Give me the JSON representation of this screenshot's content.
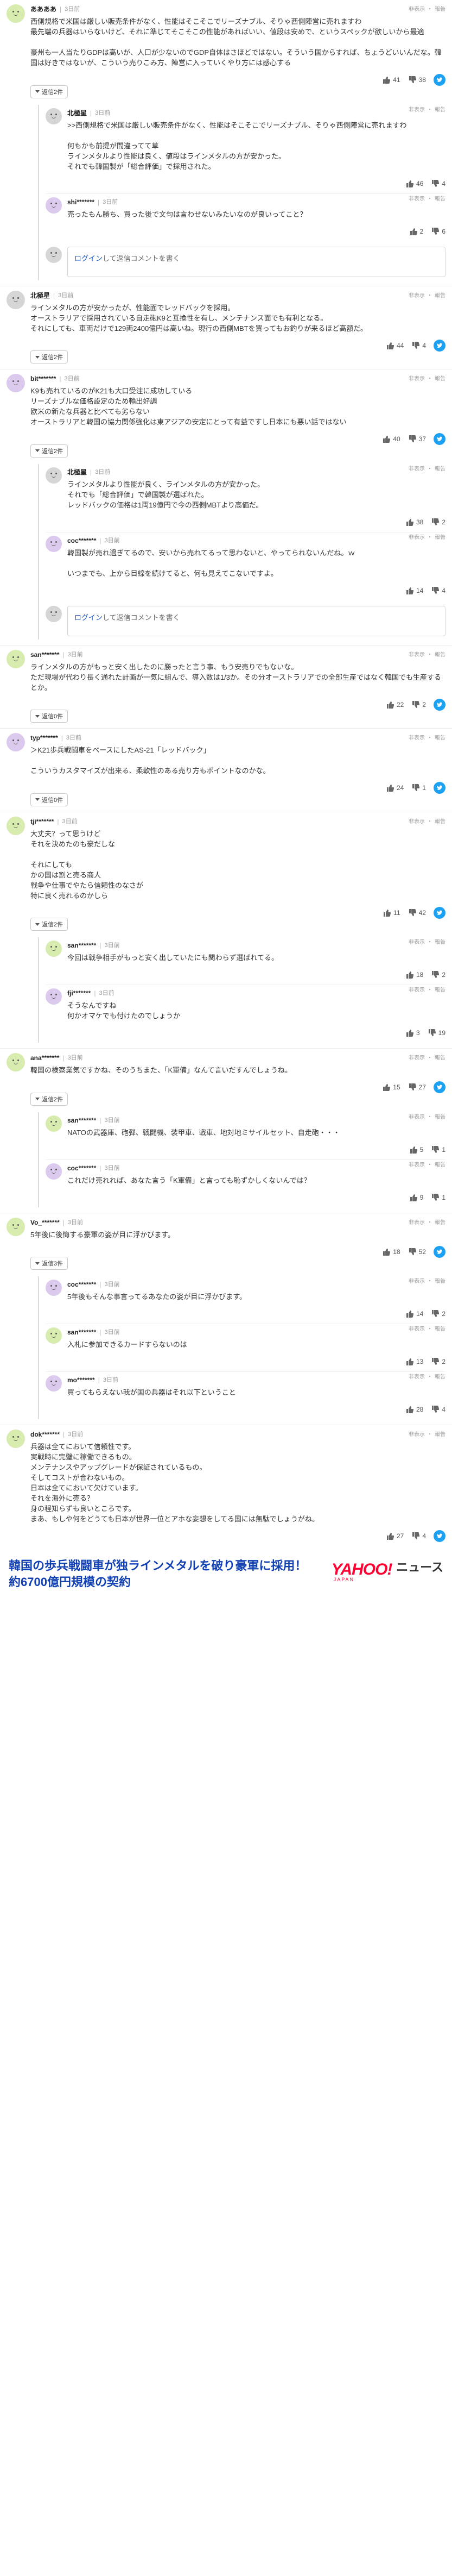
{
  "ui": {
    "reply_label": "返信",
    "report_labels": [
      "非表示",
      "報告"
    ],
    "login_link": "ログイン",
    "login_suffix": "して返信コメントを書く"
  },
  "threads": [
    {
      "author": "ああああ",
      "time": "3日前",
      "avatar": "green",
      "text": "西側規格で米国は厳しい販売条件がなく、性能はそこそこでリーズナブル、そりゃ西側陣営に売れますわ\n最先端の兵器はいらないけど、それに準じてそこそこの性能があればいい、値段は安めで、というスペックが欲しいから最適\n\n豪州も一人当たりGDPは高いが、人口が少ないのでGDP自体はさほどではない。そういう国からすれば、ちょうどいいんだな。韓国は好きではないが、こういう売りこみ方、陣営に入っていくやり方には感心する",
      "likes": "41",
      "dislikes": "38",
      "reply_count": "返信2件",
      "replies": [
        {
          "author": "北極星",
          "time": "3日前",
          "avatar": "gray",
          "text": ">>西側規格で米国は厳しい販売条件がなく、性能はそこそこでリーズナブル、そりゃ西側陣営に売れますわ\n\n何もかも前提が間違ってて草\nラインメタルより性能は良く、値段はラインメタルの方が安かった。\nそれでも韓国製が「総合評価」で採用された。",
          "likes": "46",
          "dislikes": "4"
        },
        {
          "author": "shi*******",
          "time": "3日前",
          "avatar": "purple",
          "text": "売ったもん勝ち、買った後で文句は言わせないみたいなのが良いってこと？",
          "likes": "2",
          "dislikes": "6"
        }
      ],
      "login_form": true
    },
    {
      "author": "北極星",
      "time": "3日前",
      "avatar": "gray",
      "text": "ラインメタルの方が安かったが、性能面でレッドバックを採用。\nオーストラリアで採用されている自走砲K9と互換性を有し、メンテナンス面でも有利となる。\nそれにしても、車両だけで129両2400億円は高いね。現行の西側MBTを買ってもお釣りが来るほど高額だ。",
      "likes": "44",
      "dislikes": "4",
      "reply_count": "返信2件",
      "replies": []
    },
    {
      "author": "bit*******",
      "time": "3日前",
      "avatar": "purple",
      "text": "K9も売れているのがK21も大口受注に成功している\nリーズナブルな価格設定のため輸出好調\n欧米の新たな兵器と比べても劣らない\nオーストラリアと韓国の協力関係強化は東アジアの安定にとって有益ですし日本にも悪い話ではない",
      "likes": "40",
      "dislikes": "37",
      "reply_count": "返信2件",
      "replies": [
        {
          "author": "北極星",
          "time": "3日前",
          "avatar": "gray",
          "text": "ラインメタルより性能が良く、ラインメタルの方が安かった。\nそれでも「総合評価」で韓国製が選ばれた。\nレッドバックの価格は1両19億円で今の西側MBTより高価だ。",
          "likes": "38",
          "dislikes": "2"
        },
        {
          "author": "coc*******",
          "time": "3日前",
          "avatar": "purple",
          "text": "韓国製が売れ過ぎてるので、安いから売れてるって思わないと、やってられないんだね。ｗ\n\nいつまでも、上から目線を続けてると、何も見えてこないですよ。",
          "likes": "14",
          "dislikes": "4"
        }
      ],
      "login_form": true
    },
    {
      "author": "san*******",
      "time": "3日前",
      "avatar": "green",
      "text": "ラインメタルの方がもっと安く出したのに勝ったと言う事、もう安売りでもないな。\nただ現場が代わり長く通れた計画が一気に組んで、導入数は1/3か。その分オーストラリアでの全部生産ではなく韓国でも生産するとか。",
      "likes": "22",
      "dislikes": "2",
      "reply_count": "返信0件",
      "replies": []
    },
    {
      "author": "typ*******",
      "time": "3日前",
      "avatar": "purple",
      "text": "＞K21歩兵戦闘車をベースにしたAS-21「レッドバック」\n\nこういうカスタマイズが出来る、柔軟性のある売り方もポイントなのかな。",
      "likes": "24",
      "dislikes": "1",
      "reply_count": "返信0件",
      "replies": []
    },
    {
      "author": "tji*******",
      "time": "3日前",
      "avatar": "green",
      "text": "大丈夫？って思うけど\nそれを決めたのも豪だしな\n\nそれにしても\nかの国は割と売る商人\n戦争や仕事でやたら信頼性のなさが\n特に良く売れるのかしら",
      "likes": "11",
      "dislikes": "42",
      "reply_count": "返信2件",
      "replies": [
        {
          "author": "san*******",
          "time": "3日前",
          "avatar": "green",
          "text": "今回は戦争相手がもっと安く出していたにも関わらず選ばれてる。",
          "likes": "18",
          "dislikes": "2"
        },
        {
          "author": "fji*******",
          "time": "3日前",
          "avatar": "purple",
          "text": "そうなんですね\n何かオマケでも付けたのでしょうか",
          "likes": "3",
          "dislikes": "19"
        }
      ]
    },
    {
      "author": "ana*******",
      "time": "3日前",
      "avatar": "green",
      "text": "韓国の検察業気ですかね、そのうちまた、「K軍備」なんて言いだすんでしょうね。",
      "likes": "15",
      "dislikes": "27",
      "reply_count": "返信2件",
      "replies": [
        {
          "author": "san*******",
          "time": "3日前",
          "avatar": "green",
          "text": "NATOの武器庫、砲弾、戦闘機、装甲車、戦車、地対地ミサイルセット、自走砲・・・",
          "likes": "5",
          "dislikes": "1"
        },
        {
          "author": "coc*******",
          "time": "3日前",
          "avatar": "purple",
          "text": "これだけ売れれば、あなた言う「K軍備」と言っても恥ずかしくないんでは？",
          "likes": "9",
          "dislikes": "1"
        }
      ]
    },
    {
      "author": "Vo_*******",
      "time": "3日前",
      "avatar": "green",
      "text": "5年後に後悔する豪軍の姿が目に浮かびます。",
      "likes": "18",
      "dislikes": "52",
      "reply_count": "返信3件",
      "replies": [
        {
          "author": "coc*******",
          "time": "3日前",
          "avatar": "purple",
          "text": "5年後もそんな事言ってるあなたの姿が目に浮かびます。",
          "likes": "14",
          "dislikes": "2"
        },
        {
          "author": "san*******",
          "time": "3日前",
          "avatar": "green",
          "text": "入札に参加できるカードすらないのは",
          "likes": "13",
          "dislikes": "2"
        },
        {
          "author": "mo*******",
          "time": "3日前",
          "avatar": "purple",
          "text": "買ってもらえない我が国の兵器はそれ以下ということ",
          "likes": "28",
          "dislikes": "4"
        }
      ]
    },
    {
      "author": "dok*******",
      "time": "3日前",
      "avatar": "green",
      "text": "兵器は全てにおいて信頼性です。\n実戦時に完璧に稼働できるもの。\nメンテナンスやアップグレードが保証されているもの。\nそしてコストが合わないもの。\n日本は全てにおいて欠けています。\nそれを海外に売る？\n身の程知らずも良いところです。\nまあ、もしや何をどうても日本が世界一位とアホな妄想をしてる国には無駄でしょうがね。",
      "likes": "27",
      "dislikes": "4",
      "reply_count": "",
      "replies": []
    }
  ],
  "article": {
    "title": "韓国の歩兵戦闘車が独ラインメタルを破り豪軍に採用！ 約6700億円規模の契約",
    "publisher_logo": "YAHOO!",
    "publisher_sub": "JAPAN",
    "publisher_section": "ニュース"
  },
  "colors": {
    "link": "#1a56c9",
    "title": "#1140b3",
    "yahoo_red": "#ff0033",
    "twitter": "#1da1f2"
  }
}
